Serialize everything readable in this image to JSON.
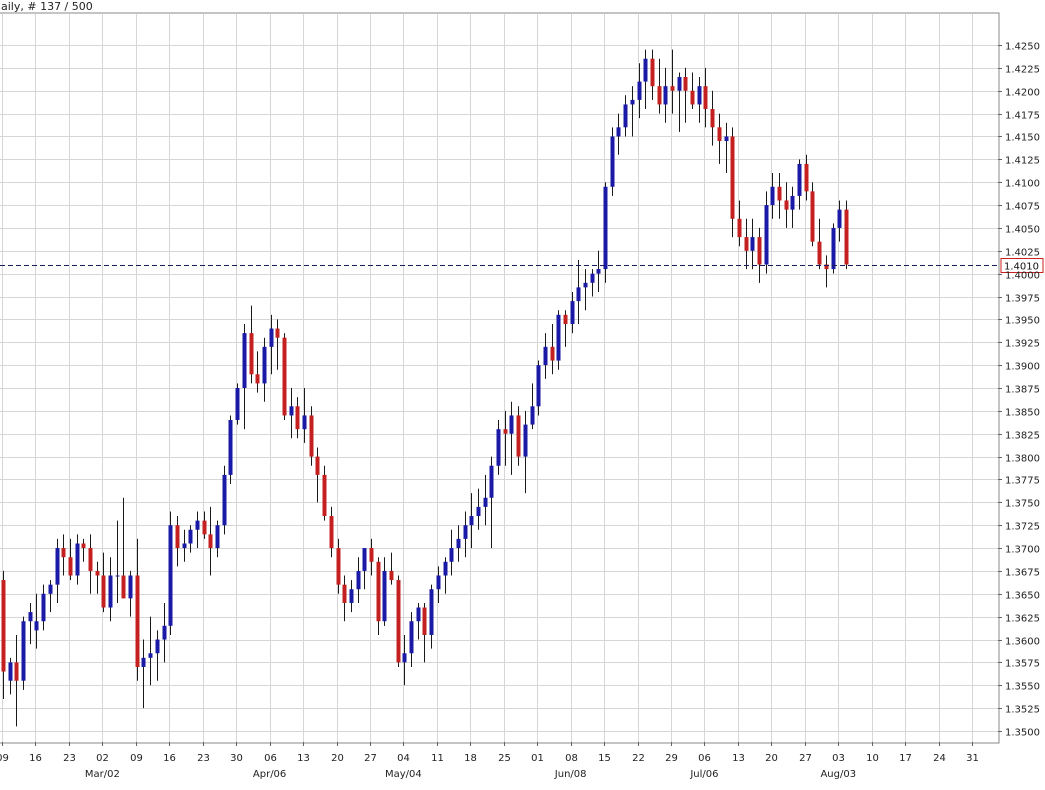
{
  "header": {
    "title": "aily, # 137 / 500"
  },
  "colors": {
    "bull": "#1a1aa6",
    "bear": "#c42020",
    "wick": "#1a1a1a",
    "grid": "#d6d6d6",
    "last_price_line": "#1a1a5e",
    "last_price_box_border": "#cc1f1f"
  },
  "chart_data": {
    "type": "candlestick",
    "title": "",
    "ylim": [
      1.3488,
      1.4285
    ],
    "y_ticks": [
      "1.3500",
      "1.3525",
      "1.3550",
      "1.3575",
      "1.3600",
      "1.3625",
      "1.3650",
      "1.3675",
      "1.3700",
      "1.3725",
      "1.3750",
      "1.3775",
      "1.3800",
      "1.3825",
      "1.3850",
      "1.3875",
      "1.3900",
      "1.3925",
      "1.3950",
      "1.3975",
      "1.4000",
      "1.4025",
      "1.4050",
      "1.4075",
      "1.4100",
      "1.4125",
      "1.4150",
      "1.4175",
      "1.4200",
      "1.4225",
      "1.4250"
    ],
    "x_day_labels": [
      "09",
      "16",
      "23",
      "02",
      "09",
      "16",
      "23",
      "30",
      "06",
      "13",
      "20",
      "27",
      "04",
      "11",
      "18",
      "25",
      "01",
      "08",
      "15",
      "22",
      "29",
      "06",
      "13",
      "20",
      "27",
      "03",
      "10",
      "17",
      "24",
      "31"
    ],
    "x_month_labels": [
      {
        "label": "Mar/02",
        "at": 3
      },
      {
        "label": "Apr/06",
        "at": 8
      },
      {
        "label": "May/04",
        "at": 12
      },
      {
        "label": "Jun/08",
        "at": 17
      },
      {
        "label": "Jul/06",
        "at": 21
      },
      {
        "label": "Aug/03",
        "at": 25
      }
    ],
    "last_price": "1.4010",
    "last_price_value": 1.401,
    "candles": [
      [
        1.3665,
        1.3675,
        1.3535,
        1.3565
      ],
      [
        1.3555,
        1.358,
        1.354,
        1.3575
      ],
      [
        1.3575,
        1.3605,
        1.3505,
        1.3555
      ],
      [
        1.3555,
        1.3625,
        1.3545,
        1.362
      ],
      [
        1.362,
        1.364,
        1.3595,
        1.363
      ],
      [
        1.361,
        1.365,
        1.359,
        1.362
      ],
      [
        1.362,
        1.366,
        1.361,
        1.365
      ],
      [
        1.365,
        1.3665,
        1.363,
        1.366
      ],
      [
        1.366,
        1.371,
        1.364,
        1.37
      ],
      [
        1.37,
        1.3715,
        1.367,
        1.369
      ],
      [
        1.369,
        1.371,
        1.3665,
        1.367
      ],
      [
        1.367,
        1.3715,
        1.366,
        1.3705
      ],
      [
        1.3705,
        1.371,
        1.3685,
        1.37
      ],
      [
        1.37,
        1.3715,
        1.365,
        1.3675
      ],
      [
        1.3675,
        1.3685,
        1.365,
        1.367
      ],
      [
        1.367,
        1.3695,
        1.363,
        1.3635
      ],
      [
        1.3635,
        1.369,
        1.362,
        1.367
      ],
      [
        1.367,
        1.373,
        1.364,
        1.367
      ],
      [
        1.367,
        1.3755,
        1.3645,
        1.3645
      ],
      [
        1.3645,
        1.3675,
        1.3625,
        1.367
      ],
      [
        1.367,
        1.371,
        1.3555,
        1.357
      ],
      [
        1.357,
        1.36,
        1.3525,
        1.358
      ],
      [
        1.358,
        1.3625,
        1.355,
        1.3585
      ],
      [
        1.3585,
        1.361,
        1.3555,
        1.36
      ],
      [
        1.36,
        1.364,
        1.3575,
        1.3615
      ],
      [
        1.3615,
        1.374,
        1.3605,
        1.3725
      ],
      [
        1.3725,
        1.3735,
        1.368,
        1.37
      ],
      [
        1.37,
        1.372,
        1.3685,
        1.3705
      ],
      [
        1.3705,
        1.3725,
        1.3695,
        1.372
      ],
      [
        1.372,
        1.374,
        1.37,
        1.373
      ],
      [
        1.373,
        1.374,
        1.371,
        1.3715
      ],
      [
        1.3715,
        1.3745,
        1.367,
        1.37
      ],
      [
        1.37,
        1.373,
        1.369,
        1.3725
      ],
      [
        1.3725,
        1.379,
        1.3715,
        1.378
      ],
      [
        1.378,
        1.3845,
        1.377,
        1.384
      ],
      [
        1.384,
        1.388,
        1.3835,
        1.3875
      ],
      [
        1.3875,
        1.3945,
        1.383,
        1.3935
      ],
      [
        1.3935,
        1.3965,
        1.388,
        1.389
      ],
      [
        1.389,
        1.3915,
        1.387,
        1.388
      ],
      [
        1.388,
        1.393,
        1.386,
        1.392
      ],
      [
        1.392,
        1.3955,
        1.389,
        1.394
      ],
      [
        1.394,
        1.395,
        1.3895,
        1.393
      ],
      [
        1.393,
        1.3935,
        1.384,
        1.3845
      ],
      [
        1.3845,
        1.3875,
        1.382,
        1.3855
      ],
      [
        1.3855,
        1.3865,
        1.382,
        1.383
      ],
      [
        1.383,
        1.3875,
        1.3815,
        1.3845
      ],
      [
        1.3845,
        1.3855,
        1.379,
        1.38
      ],
      [
        1.38,
        1.381,
        1.375,
        1.378
      ],
      [
        1.378,
        1.379,
        1.373,
        1.3735
      ],
      [
        1.3735,
        1.3745,
        1.369,
        1.37
      ],
      [
        1.37,
        1.371,
        1.365,
        1.366
      ],
      [
        1.366,
        1.367,
        1.362,
        1.364
      ],
      [
        1.364,
        1.3665,
        1.363,
        1.3655
      ],
      [
        1.3655,
        1.369,
        1.364,
        1.3675
      ],
      [
        1.3675,
        1.37,
        1.3655,
        1.37
      ],
      [
        1.37,
        1.371,
        1.367,
        1.3685
      ],
      [
        1.3685,
        1.369,
        1.3605,
        1.362
      ],
      [
        1.362,
        1.369,
        1.3615,
        1.3675
      ],
      [
        1.3675,
        1.3695,
        1.366,
        1.3665
      ],
      [
        1.3665,
        1.367,
        1.357,
        1.3575
      ],
      [
        1.3575,
        1.3605,
        1.355,
        1.3585
      ],
      [
        1.3585,
        1.363,
        1.357,
        1.362
      ],
      [
        1.362,
        1.364,
        1.36,
        1.3635
      ],
      [
        1.3635,
        1.364,
        1.3575,
        1.3605
      ],
      [
        1.3605,
        1.366,
        1.359,
        1.3655
      ],
      [
        1.3655,
        1.368,
        1.364,
        1.367
      ],
      [
        1.367,
        1.369,
        1.365,
        1.3685
      ],
      [
        1.3685,
        1.372,
        1.367,
        1.37
      ],
      [
        1.37,
        1.3725,
        1.3685,
        1.371
      ],
      [
        1.371,
        1.374,
        1.369,
        1.3725
      ],
      [
        1.3725,
        1.376,
        1.37,
        1.3735
      ],
      [
        1.3735,
        1.3765,
        1.372,
        1.3745
      ],
      [
        1.3745,
        1.378,
        1.3725,
        1.3755
      ],
      [
        1.3755,
        1.38,
        1.37,
        1.379
      ],
      [
        1.379,
        1.384,
        1.378,
        1.383
      ],
      [
        1.383,
        1.385,
        1.379,
        1.3825
      ],
      [
        1.3825,
        1.386,
        1.378,
        1.3845
      ],
      [
        1.3845,
        1.3855,
        1.379,
        1.38
      ],
      [
        1.38,
        1.385,
        1.376,
        1.3835
      ],
      [
        1.3835,
        1.388,
        1.383,
        1.3855
      ],
      [
        1.3855,
        1.3905,
        1.3845,
        1.39
      ],
      [
        1.39,
        1.3935,
        1.3885,
        1.392
      ],
      [
        1.392,
        1.3945,
        1.389,
        1.3905
      ],
      [
        1.3905,
        1.396,
        1.3895,
        1.3955
      ],
      [
        1.3955,
        1.396,
        1.392,
        1.3945
      ],
      [
        1.3945,
        1.398,
        1.3935,
        1.397
      ],
      [
        1.397,
        1.4015,
        1.3945,
        1.3985
      ],
      [
        1.3985,
        1.4005,
        1.396,
        1.399
      ],
      [
        1.399,
        1.4005,
        1.3975,
        1.4
      ],
      [
        1.4,
        1.4025,
        1.398,
        1.4005
      ],
      [
        1.4005,
        1.41,
        1.399,
        1.4095
      ],
      [
        1.4095,
        1.416,
        1.4085,
        1.415
      ],
      [
        1.415,
        1.4175,
        1.413,
        1.416
      ],
      [
        1.416,
        1.4195,
        1.415,
        1.4185
      ],
      [
        1.4185,
        1.4205,
        1.415,
        1.419
      ],
      [
        1.419,
        1.423,
        1.417,
        1.421
      ],
      [
        1.421,
        1.4245,
        1.418,
        1.4235
      ],
      [
        1.4235,
        1.4245,
        1.419,
        1.4205
      ],
      [
        1.4205,
        1.4235,
        1.4175,
        1.4185
      ],
      [
        1.4185,
        1.4225,
        1.4165,
        1.4205
      ],
      [
        1.4205,
        1.4245,
        1.4175,
        1.42
      ],
      [
        1.42,
        1.422,
        1.4155,
        1.4215
      ],
      [
        1.4215,
        1.4225,
        1.4165,
        1.42
      ],
      [
        1.42,
        1.422,
        1.418,
        1.4185
      ],
      [
        1.4185,
        1.4215,
        1.4165,
        1.4205
      ],
      [
        1.4205,
        1.4225,
        1.416,
        1.418
      ],
      [
        1.418,
        1.42,
        1.414,
        1.416
      ],
      [
        1.416,
        1.4175,
        1.412,
        1.4145
      ],
      [
        1.4145,
        1.4165,
        1.411,
        1.415
      ],
      [
        1.415,
        1.416,
        1.404,
        1.406
      ],
      [
        1.406,
        1.408,
        1.403,
        1.404
      ],
      [
        1.404,
        1.406,
        1.4005,
        1.4025
      ],
      [
        1.4025,
        1.406,
        1.4005,
        1.404
      ],
      [
        1.404,
        1.405,
        1.399,
        1.401
      ],
      [
        1.401,
        1.409,
        1.4,
        1.4075
      ],
      [
        1.4075,
        1.411,
        1.406,
        1.4095
      ],
      [
        1.4095,
        1.411,
        1.406,
        1.408
      ],
      [
        1.408,
        1.41,
        1.405,
        1.407
      ],
      [
        1.407,
        1.4095,
        1.405,
        1.4085
      ],
      [
        1.4085,
        1.4125,
        1.407,
        1.412
      ],
      [
        1.412,
        1.413,
        1.408,
        1.409
      ],
      [
        1.409,
        1.41,
        1.403,
        1.4035
      ],
      [
        1.4035,
        1.406,
        1.4005,
        1.401
      ],
      [
        1.401,
        1.402,
        1.3985,
        1.4005
      ],
      [
        1.4005,
        1.4055,
        1.4,
        1.405
      ],
      [
        1.405,
        1.408,
        1.4035,
        1.407
      ],
      [
        1.407,
        1.408,
        1.4005,
        1.401
      ]
    ]
  }
}
